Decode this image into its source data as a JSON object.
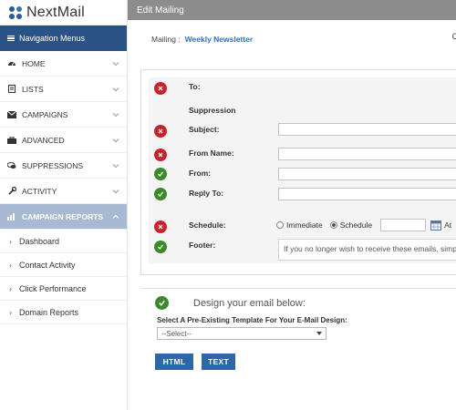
{
  "brand": {
    "name": "NextMail"
  },
  "nav": {
    "header": "Navigation Menus",
    "items": [
      {
        "label": "HOME",
        "icon": "dashboard-icon"
      },
      {
        "label": "LISTS",
        "icon": "document-icon"
      },
      {
        "label": "CAMPAIGNS",
        "icon": "envelope-icon"
      },
      {
        "label": "ADVANCED",
        "icon": "briefcase-icon"
      },
      {
        "label": "SUPPRESSIONS",
        "icon": "comments-icon"
      },
      {
        "label": "ACTIVITY",
        "icon": "wrench-icon"
      },
      {
        "label": "CAMPAIGN REPORTS",
        "icon": "bar-chart-icon"
      }
    ],
    "sub_items": [
      {
        "label": "Dashboard"
      },
      {
        "label": "Contact Activity"
      },
      {
        "label": "Click Performance"
      },
      {
        "label": "Domain Reports"
      }
    ]
  },
  "main": {
    "title": "Edit Mailing",
    "mailing_label": "Mailing :",
    "mailing_value": "Weekly Newsletter",
    "cut_text": "C"
  },
  "form": {
    "to_label": "To:",
    "suppression_label": "Suppression",
    "subject_label": "Subject:",
    "from_name_label": "From Name:",
    "from_label": "From:",
    "reply_to_label": "Reply To:",
    "schedule_label": "Schedule:",
    "immediate_label": "Immediate",
    "schedule_option_label": "Schedule",
    "at_label": "At",
    "footer_label": "Footer:",
    "footer_text": "If you no longer wish to receive these emails, simply"
  },
  "design": {
    "title": "Design your email below:",
    "template_label": "Select A Pre-Existing Template For Your E-Mail Design:",
    "template_selected": "--Select--",
    "html_button": "HTML",
    "text_button": "TEXT"
  },
  "colors": {
    "nav_header": "#2b5284",
    "active_nav": "#a7b9d3",
    "error": "#c8222c",
    "ok": "#3d8a2c",
    "button": "#2d67a8"
  }
}
